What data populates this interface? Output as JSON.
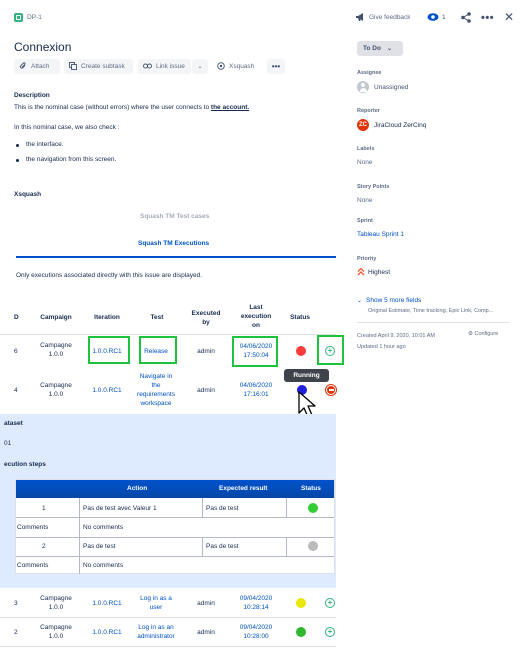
{
  "header": {
    "breadcrumb": "DP-1",
    "give_feedback": "Give feedback",
    "watchers": "1"
  },
  "issue": {
    "title": "Connexion",
    "toolbar": {
      "attach": "Attach",
      "create_subtask": "Create subtask",
      "link_issue": "Link issue",
      "xsquash": "Xsquash"
    },
    "description_label": "Description",
    "description_text": "This is the nominal case (without errors) where the user connects to ",
    "description_link": "the account.",
    "check_text": "In this nominal case, we also check :",
    "bullets": [
      "the interface.",
      "the navigation from this screen."
    ]
  },
  "xsquash": {
    "section_label": "Xsquash",
    "test_cases_tab": "Squash TM Test cases",
    "executions_tab": "Squash TM Executions",
    "only_note": "Only executions associated directly with this issue are displayed.",
    "columns": {
      "id": "D",
      "campaign": "Campaign",
      "iteration": "Iteration",
      "test": "Test",
      "executed_by_1": "Executed",
      "executed_by_2": "by",
      "last_exec_1": "Last",
      "last_exec_2": "execution",
      "last_exec_3": "on",
      "status": "Status"
    },
    "rows": [
      {
        "id": "6",
        "campaign": [
          "Campagne",
          "1.0.0"
        ],
        "iteration": "1.0.0.RC1",
        "test": [
          "Release"
        ],
        "executed_by": "admin",
        "date": "04/06/2020",
        "time": "17:50:04",
        "status_color": "#ff3b3b"
      },
      {
        "id": "4",
        "campaign": [
          "Campagne",
          "1.0.0"
        ],
        "iteration": "1.0.0.RC1",
        "test": [
          "Navigate in",
          "the",
          "requirements",
          "workspace"
        ],
        "executed_by": "admin",
        "date": "04/06/2020",
        "time": "17:16:01",
        "status_color": "#2020dd"
      },
      {
        "id": "3",
        "campaign": [
          "Campagne",
          "1.0.0"
        ],
        "iteration": "1.0.0.RC1",
        "test": [
          "Log in as a",
          "user"
        ],
        "executed_by": "admin",
        "date": "09/04/2020",
        "time": "10:28:14",
        "status_color": "#e8e800"
      },
      {
        "id": "2",
        "campaign": [
          "Campagne",
          "1.0.0"
        ],
        "iteration": "1.0.0.RC1",
        "test": [
          "Log in as an",
          "administrator"
        ],
        "executed_by": "admin",
        "date": "09/04/2020",
        "time": "10:28:00",
        "status_color": "#2eb82e"
      }
    ],
    "tooltip": "Running",
    "detail": {
      "dataset_label": "ataset",
      "dataset_value": "01",
      "steps_label": "ecution steps",
      "steps_columns": {
        "action": "Action",
        "expected": "Expected result",
        "status": "Status"
      },
      "steps": [
        {
          "num": "1",
          "action": "Pas de test avec Valeur 1",
          "expected": "Pas de test",
          "status_color": "#33cc33",
          "comments_label": "Comments",
          "comments_value": "No comments"
        },
        {
          "num": "2",
          "action": "Pas de test",
          "expected": "Pas de test",
          "status_color": "#bbbbbb",
          "comments_label": "Comments",
          "comments_value": "No comments"
        }
      ]
    }
  },
  "sidebar": {
    "status": "To Do",
    "assignee_label": "Assignee",
    "assignee_value": "Unassigned",
    "reporter_label": "Reporter",
    "reporter_value": "JiraCloud ZerCinq",
    "labels_label": "Labels",
    "labels_value": "None",
    "story_points_label": "Story Points",
    "story_points_value": "None",
    "sprint_label": "Sprint",
    "sprint_value": "Tableau Sprint 1",
    "priority_label": "Priority",
    "priority_value": "Highest",
    "show_more": "Show 5 more fields",
    "show_more_sub": "Original Estimate, Time tracking, Epic Link, Comp...",
    "created": "Created April 9, 2020, 10:01 AM",
    "updated": "Updated 1 hour ago",
    "configure": "Configure"
  },
  "colors": {
    "link": "#0052cc",
    "accent_box": "#1bc43c",
    "table_header": "#0747a6",
    "detail_bg": "#deebff"
  }
}
